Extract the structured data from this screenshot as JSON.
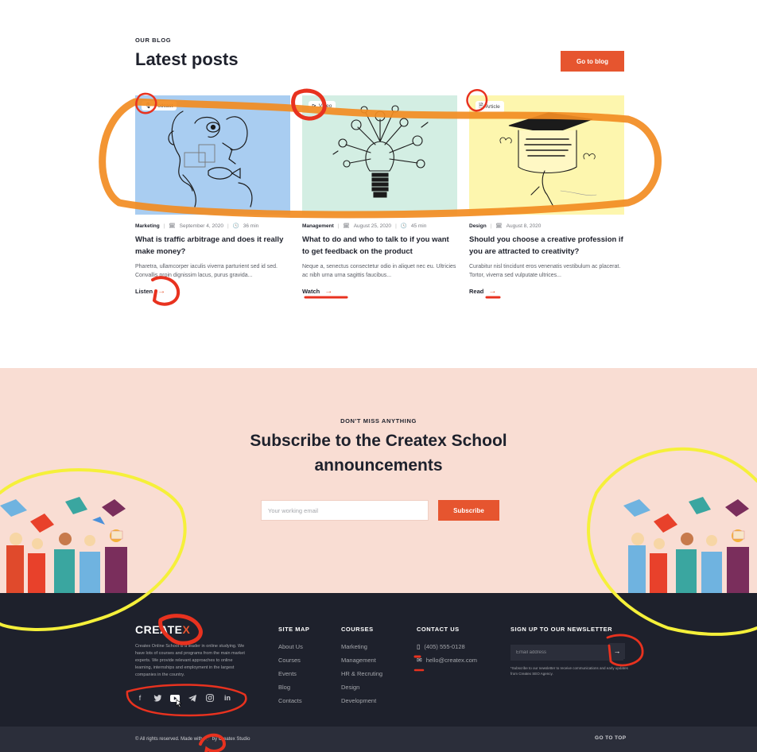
{
  "blog": {
    "eyebrow": "OUR BLOG",
    "title": "Latest posts",
    "button_label": "Go to blog",
    "posts": [
      {
        "tag_icon": "microphone-icon",
        "tag": "Podcast",
        "image_bg": "#a9cdf1",
        "category": "Marketing",
        "date": "September 4, 2020",
        "duration": "36 min",
        "title": "What is traffic arbitrage and does it really make money?",
        "excerpt": "Pharetra, ullamcorper iaculis viverra parturient sed id sed. Convallis proin dignissim lacus, purus gravida...",
        "cta": "Listen"
      },
      {
        "tag_icon": "play-icon",
        "tag": "Video",
        "image_bg": "#d3eee3",
        "category": "Management",
        "date": "August 25, 2020",
        "duration": "45 min",
        "title": "What to do and who to talk to if you want to get feedback on the product",
        "excerpt": "Neque a, senectus consectetur odio in aliquet nec eu. Ultricies ac nibh urna urna sagittis faucibus...",
        "cta": "Watch"
      },
      {
        "tag_icon": "file-icon",
        "tag": "Article",
        "image_bg": "#fdf6ae",
        "category": "Design",
        "date": "August 8, 2020",
        "duration": "",
        "title": "Should you choose a creative profession if you are attracted to creativity?",
        "excerpt": "Curabitur nisl tincidunt eros venenatis vestibulum ac placerat. Tortor, viverra sed vulputate ultrices...",
        "cta": "Read"
      }
    ]
  },
  "subscribe": {
    "eyebrow": "DON'T MISS ANYTHING",
    "title": "Subscribe to the Createx School announcements",
    "placeholder": "Your working email",
    "button_label": "Subscribe"
  },
  "footer": {
    "logo_main": "CREATE",
    "logo_accent": "X",
    "about": "Createx Online School is a leader in online studying. We have lots of courses and programs from the main market experts. We provide relevant approaches to online learning, internships and employment in the largest companies in the country.",
    "socials": [
      "facebook-icon",
      "twitter-icon",
      "youtube-icon",
      "telegram-icon",
      "instagram-icon",
      "linkedin-icon"
    ],
    "site_map": {
      "heading": "SITE MAP",
      "links": [
        "About Us",
        "Courses",
        "Events",
        "Blog",
        "Contacts"
      ]
    },
    "courses": {
      "heading": "COURSES",
      "links": [
        "Marketing",
        "Management",
        "HR & Recruting",
        "Design",
        "Development"
      ]
    },
    "contact": {
      "heading": "CONTACT US",
      "phone": "(405) 555-0128",
      "email": "hello@createx.com"
    },
    "newsletter": {
      "heading": "SIGN UP TO OUR NEWSLETTER",
      "placeholder": "Email address",
      "note": "*Subscribe to our newsletter to receive communications and early updates from Createx SEO Agency."
    },
    "copyright_prefix": "© All rights reserved. Made with",
    "copyright_suffix": "by Createx Studio",
    "go_top": "GO TO TOP"
  },
  "colors": {
    "accent": "#e6552f",
    "dark": "#1e212c",
    "peach": "#f9ddd3",
    "annotation_orange": "#f28c22",
    "annotation_red": "#e8321f",
    "annotation_yellow": "#f5f03a"
  }
}
